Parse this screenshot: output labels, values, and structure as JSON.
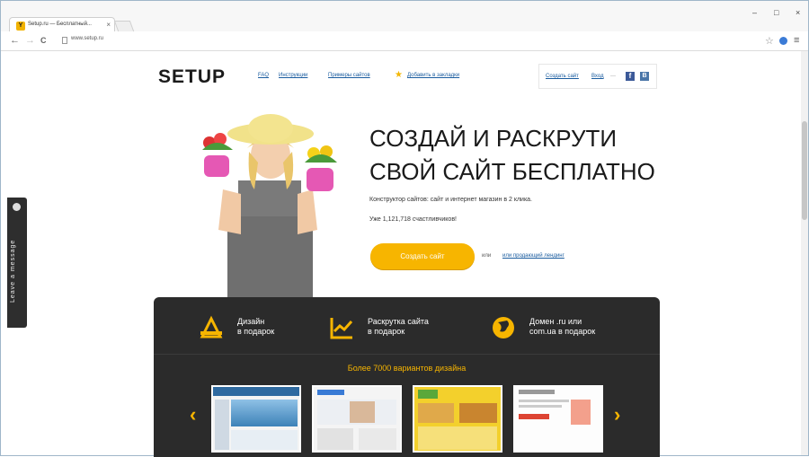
{
  "browser": {
    "tab_title": "Setup.ru — Бесплатный...",
    "tab_favicon": "Y",
    "tab_close": "×",
    "url": "www.setup.ru",
    "win_minimize": "–",
    "win_maximize": "□",
    "win_close": "×",
    "back": "←",
    "forward": "→",
    "reload": "C",
    "star": "☆",
    "menu": "≡"
  },
  "leave_message": "Leave a message",
  "header": {
    "logo": "SETUP",
    "nav": [
      "FAQ",
      "Инструкции",
      "Примеры сайтов"
    ],
    "bookmark": "Добавить в закладки",
    "create_site": "Создать сайт",
    "login": "Вход",
    "facebook": "f",
    "vk": "B"
  },
  "hero": {
    "title_line1": "СОЗДАЙ И РАСКРУТИ",
    "title_line2": "СВОЙ САЙТ БЕСПЛАТНО",
    "subtitle": "Конструктор сайтов: сайт и интернет магазин в 2 клика.",
    "counter": "Уже 1,121,718 счастливчиков!",
    "cta": "Создать сайт",
    "or": "или",
    "alt_link": "или продающий лендинг"
  },
  "features": [
    {
      "line1": "Дизайн",
      "line2": "в подарок",
      "icon": "design-icon"
    },
    {
      "line1": "Раскрутка сайта",
      "line2": "в подарок",
      "icon": "chart-icon"
    },
    {
      "line1": "Домен .ru или",
      "line2": "com.ua в подарок",
      "icon": "globe-icon"
    }
  ],
  "designs_title": "Более 7000 вариантов дизайна",
  "carousel": {
    "prev": "‹",
    "next": "›"
  },
  "colors": {
    "accent": "#f7b500",
    "dark_panel": "#2b2b2b",
    "link": "#1a5c9f"
  }
}
